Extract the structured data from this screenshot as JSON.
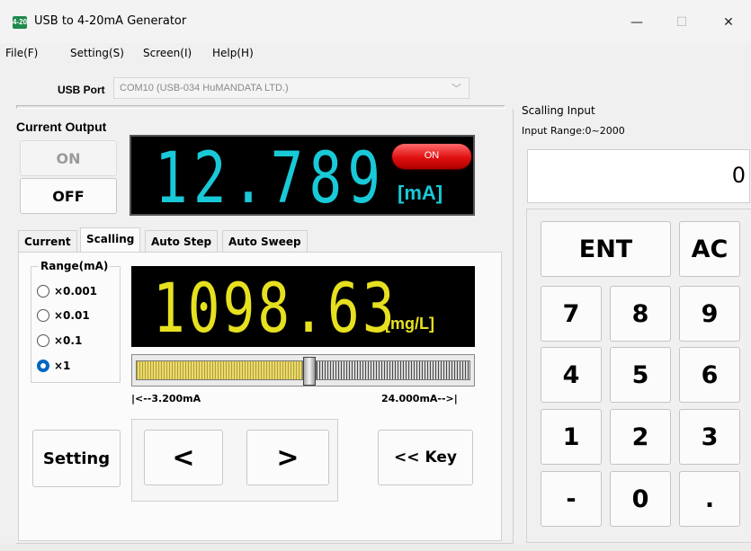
{
  "window": {
    "icon_text": "4-20",
    "title": "USB to 4-20mA Generator",
    "minimize": "—",
    "maximize": "☐",
    "close": "✕"
  },
  "menu": [
    "File(F)",
    "Setting(S)",
    "Screen(I)",
    "Help(H)"
  ],
  "usb": {
    "label": "USB Port",
    "value": "COM10 (USB-034 HuMANDATA LTD.)"
  },
  "current_output": {
    "title": "Current Output",
    "on_button": "ON",
    "off_button": "OFF",
    "display_value": "12.789",
    "display_unit": "[mA]",
    "status_pill": "ON",
    "colors": {
      "display": "#19c9d8",
      "pill": "#e01010"
    }
  },
  "tabs": [
    {
      "label": "Current",
      "active": false
    },
    {
      "label": "Scalling",
      "active": true
    },
    {
      "label": "Auto Step",
      "active": false
    },
    {
      "label": "Auto Sweep",
      "active": false
    }
  ],
  "range": {
    "title": "Range(mA)",
    "options": [
      {
        "label": "×0.001",
        "selected": false
      },
      {
        "label": "×0.01",
        "selected": false
      },
      {
        "label": "×0.1",
        "selected": false
      },
      {
        "label": "×1",
        "selected": true
      }
    ]
  },
  "scaled_display": {
    "value": "1098.63",
    "unit": "[mg/L]",
    "color": "#e6e020"
  },
  "slider": {
    "level": 0.518,
    "min_label": "|<--3.200mA",
    "max_label": "24.000mA-->|"
  },
  "buttons": {
    "setting": "Setting",
    "prev": "<",
    "next": ">",
    "key": "<< Key"
  },
  "scaling_input": {
    "heading": "Scalling Input",
    "range_text": "Input Range:0~2000",
    "value": "0"
  },
  "keypad": [
    "ENT",
    "AC",
    "7",
    "8",
    "9",
    "4",
    "5",
    "6",
    "1",
    "2",
    "3",
    "-",
    "0",
    "."
  ]
}
